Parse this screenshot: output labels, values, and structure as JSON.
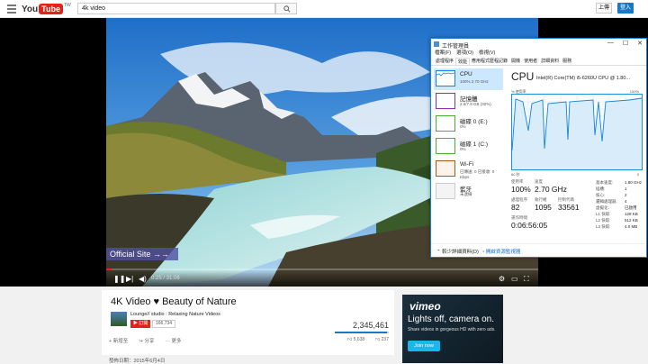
{
  "header": {
    "logo_you": "You",
    "logo_tube": "Tube",
    "logo_region": "TW",
    "search_value": "4k video",
    "upload_label": "上傳",
    "signin_label": "登入",
    "brand_color": "#e62117",
    "accent_color": "#167ac6"
  },
  "player": {
    "overlay_link": "Official Site →→",
    "time_text": "0:25 / 31:06",
    "progress_fraction": 0.013
  },
  "taskmgr": {
    "title": "工作管理員",
    "menu": [
      "檔案(F)",
      "選項(O)",
      "檢視(V)"
    ],
    "tabs": [
      "處理程序",
      "效能",
      "應用程式歷程記錄",
      "開機",
      "使用者",
      "詳細資料",
      "服務"
    ],
    "active_tab_index": 1,
    "resources": [
      {
        "name": "CPU",
        "value": "100% 2.70 GHz",
        "color": "#1883d7"
      },
      {
        "name": "記憶體",
        "value": "2.5/7.8 GB (32%)",
        "color": "#8b2fb5"
      },
      {
        "name": "磁碟 0 (E:)",
        "value": "0%",
        "color": "#4cae34"
      },
      {
        "name": "磁碟 1 (C:)",
        "value": "0%",
        "color": "#4cae34"
      },
      {
        "name": "Wi-Fi",
        "value": "已傳送: 0 已接收: 0 Kbps",
        "color": "#a7591c"
      },
      {
        "name": "藍牙",
        "value": "未連線",
        "color": "#999999"
      }
    ],
    "cpu_title": "CPU",
    "cpu_model": "Intel(R) Core(TM) i5-6260U CPU @ 1.80...",
    "graph_label_left": "% 使用率",
    "graph_label_right": "100%",
    "graph_bottom_left": "60 秒",
    "graph_bottom_right": "0",
    "stats": [
      {
        "label": "使用率",
        "value": "100%"
      },
      {
        "label": "速度",
        "value": "2.70 GHz"
      },
      {
        "label": "處理程序",
        "value": "82"
      },
      {
        "label": "執行緒",
        "value": "1095"
      },
      {
        "label": "控制代碼",
        "value": "33561"
      },
      {
        "label": "運作時間",
        "value": "0:06:56:05"
      }
    ],
    "specs": [
      {
        "label": "基本速度:",
        "value": "1.80 GHz"
      },
      {
        "label": "插槽:",
        "value": "1"
      },
      {
        "label": "核心:",
        "value": "2"
      },
      {
        "label": "邏輯處理器:",
        "value": "4"
      },
      {
        "label": "虛擬化:",
        "value": "已啟用"
      },
      {
        "label": "L1 快取:",
        "value": "128 KB"
      },
      {
        "label": "L2 快取:",
        "value": "512 KB"
      },
      {
        "label": "L3 快取:",
        "value": "4.0 MB"
      }
    ],
    "footer_fewer": "較少詳細資料(D)",
    "footer_monitor": "開啟資源監視器"
  },
  "video_info": {
    "title": "4K Video ♥ Beauty of Nature",
    "channel": "Lounge// studio : Relaxing Nature Videos",
    "subscribe_label": "訂閱",
    "subscriber_count": "166,734",
    "views": "2,345,461",
    "like_ratio": 0.96,
    "add_to_label": "新增至",
    "share_label": "分享",
    "more_label": "更多",
    "likes": "5,638",
    "dislikes": "237",
    "publish_date": "發佈日期：2015年6月4日"
  },
  "ad": {
    "brand": "vimeo",
    "headline": "Lights off, camera on.",
    "subtext": "Share videos in gorgeous HD with zero ads.",
    "cta": "Join now"
  }
}
